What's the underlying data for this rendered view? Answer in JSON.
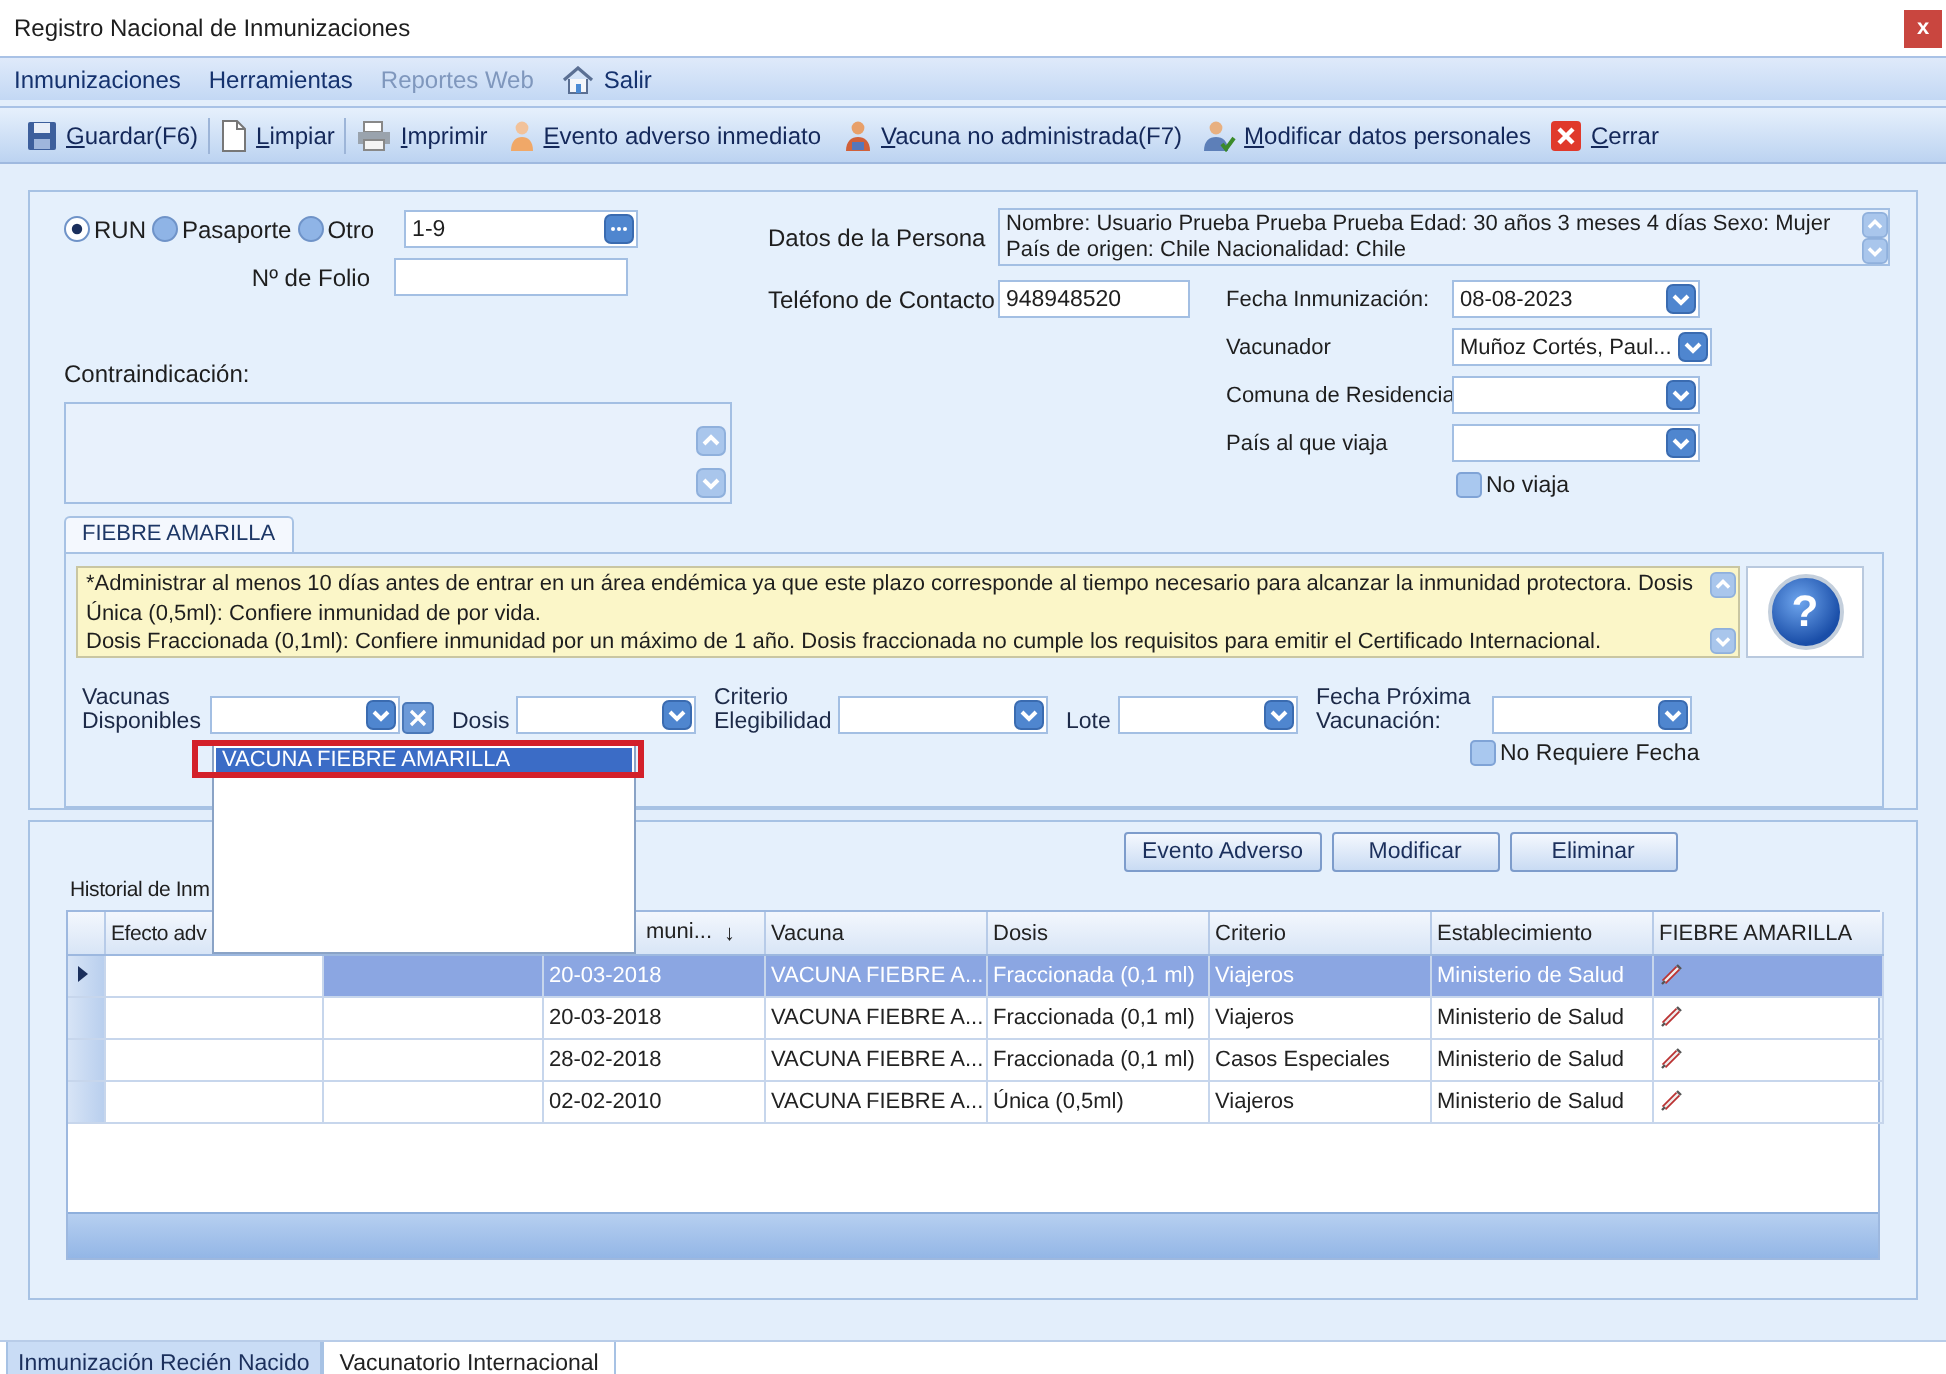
{
  "window": {
    "title": "Registro Nacional de Inmunizaciones",
    "close": "x"
  },
  "menu": [
    {
      "label": "Inmunizaciones",
      "disabled": false
    },
    {
      "label": "Herramientas",
      "disabled": false
    },
    {
      "label": "Reportes Web",
      "disabled": true
    },
    {
      "label": "Salir",
      "disabled": false,
      "kind": "exit"
    }
  ],
  "toolbar": [
    {
      "label": "Guardar(F6)",
      "kind": "save"
    },
    {
      "label": "Limpiar",
      "kind": "clear"
    },
    {
      "label": "Imprimir",
      "kind": "print"
    },
    {
      "label": "Evento adverso inmediato",
      "kind": "adverse"
    },
    {
      "label": "Vacuna no administrada(F7)",
      "kind": "not-given"
    },
    {
      "label": "Modificar datos personales",
      "kind": "edit-person"
    },
    {
      "label": "Cerrar",
      "kind": "close"
    }
  ],
  "identity": {
    "doc_types": [
      {
        "label": "RUN",
        "selected": true
      },
      {
        "label": "Pasaporte",
        "selected": false
      },
      {
        "label": "Otro",
        "selected": false
      }
    ],
    "run_value": "1-9",
    "folio_label": "Nº de Folio"
  },
  "contraindication": {
    "label": "Contraindicación:"
  },
  "person": {
    "label": "Datos de la Persona",
    "text": "Nombre: Usuario Prueba Prueba Prueba  Edad: 30 años 3 meses 4 días  Sexo: Mujer País de origen: Chile Nacionalidad: Chile"
  },
  "phone": {
    "label": "Teléfono de Contacto",
    "value": "948948520"
  },
  "right_fields": [
    {
      "label": "Fecha Inmunización:",
      "value": "08-08-2023"
    },
    {
      "label": "Vacunador",
      "value": "Muñoz Cortés, Paul..."
    },
    {
      "label": "Comuna de Residencia"
    },
    {
      "label": "País al que viaja"
    }
  ],
  "no_travel": {
    "label": "No viaja",
    "checked": false
  },
  "vaccine_tab": {
    "label": "FIEBRE AMARILLA",
    "help": "?",
    "note": [
      "*Administrar al menos 10 días antes de entrar en un área endémica ya que este plazo corresponde al tiempo necesario para alcanzar la inmunidad protectora. Dosis Única (0,5ml): Confiere inmunidad de por vida.",
      "Dosis Fraccionada (0,1ml): Confiere inmunidad por un máximo de 1 año. Dosis fraccionada no cumple los requisitos para emitir el Certificado Internacional."
    ]
  },
  "dose_fields": [
    {
      "label": "Vacunas Disponibles",
      "clearable": true
    },
    {
      "label": "Dosis"
    },
    {
      "label": "Criterio Elegibilidad"
    },
    {
      "label": "Lote"
    },
    {
      "label": "Fecha Próxima Vacunación:"
    }
  ],
  "no_date": {
    "label": "No Requiere Fecha",
    "checked": false
  },
  "dropdown": {
    "options": [
      {
        "label": "VACUNA FIEBRE AMARILLA",
        "selected": true
      }
    ]
  },
  "actions": [
    "Evento Adverso",
    "Modificar",
    "Eliminar"
  ],
  "history": {
    "label": "Historial de Inm",
    "columns": [
      {
        "label": "Efecto adv"
      },
      {},
      {
        "label": "muni...",
        "sort_arrow": "↓"
      },
      {
        "label": "Vacuna"
      },
      {
        "label": "Dosis"
      },
      {
        "label": "Criterio"
      },
      {
        "label": "Establecimiento"
      },
      {
        "label": "FIEBRE AMARILLA"
      }
    ],
    "rows": [
      {
        "selected": true,
        "current": true,
        "date": "20-03-2018",
        "vaccine": "VACUNA FIEBRE A...",
        "dose": "Fraccionada (0,1 ml)",
        "criterion": "Viajeros",
        "facility": "Ministerio de Salud"
      },
      {
        "selected": false,
        "current": false,
        "date": "20-03-2018",
        "vaccine": "VACUNA FIEBRE A...",
        "dose": "Fraccionada (0,1 ml)",
        "criterion": "Viajeros",
        "facility": "Ministerio de Salud"
      },
      {
        "selected": false,
        "current": false,
        "date": "28-02-2018",
        "vaccine": "VACUNA FIEBRE A...",
        "dose": "Fraccionada (0,1 ml)",
        "criterion": "Casos Especiales",
        "facility": "Ministerio de Salud"
      },
      {
        "selected": false,
        "current": false,
        "date": "02-02-2010",
        "vaccine": "VACUNA FIEBRE A...",
        "dose": "Única (0,5ml)",
        "criterion": "Viajeros",
        "facility": "Ministerio de Salud"
      }
    ]
  },
  "bottom_tabs": [
    {
      "label": "Inmunización Recién Nacido",
      "selected": false
    },
    {
      "label": "Vacunatorio Internacional",
      "selected": true
    }
  ]
}
